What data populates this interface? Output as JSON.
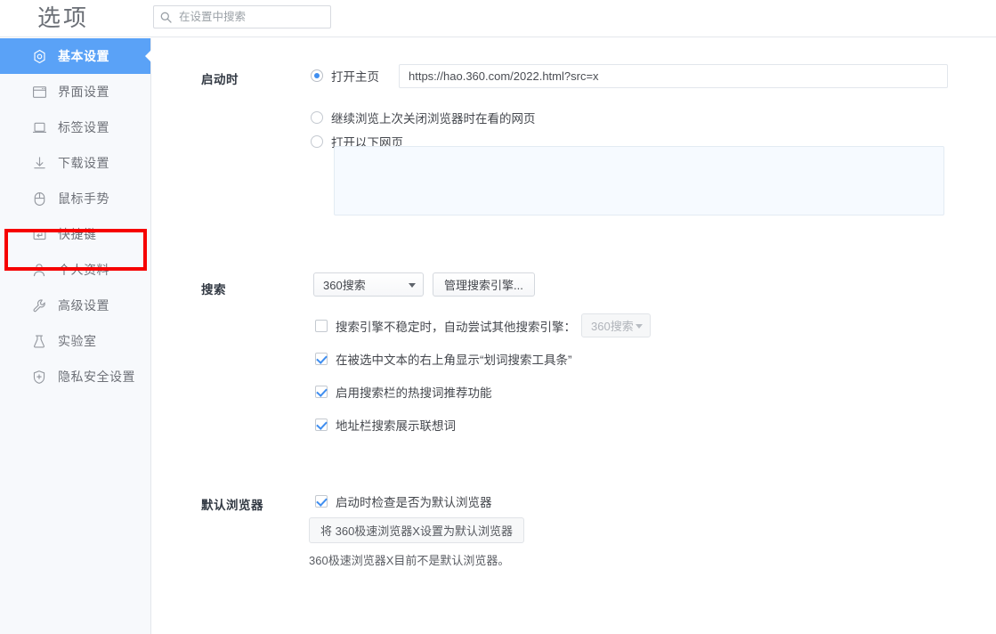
{
  "window": {
    "title": "选项"
  },
  "search": {
    "placeholder": "在设置中搜索",
    "value": "",
    "icon": "search-icon"
  },
  "sidebar": {
    "items": [
      {
        "label": "基本设置",
        "icon": "gear-target-icon",
        "active": true
      },
      {
        "label": "界面设置",
        "icon": "window-icon",
        "active": false
      },
      {
        "label": "标签设置",
        "icon": "tab-icon",
        "active": false
      },
      {
        "label": "下载设置",
        "icon": "download-icon",
        "active": false
      },
      {
        "label": "鼠标手势",
        "icon": "mouse-icon",
        "active": false
      },
      {
        "label": "快捷键",
        "icon": "keyboard-icon",
        "active": false,
        "highlighted": true
      },
      {
        "label": "个人资料",
        "icon": "user-icon",
        "active": false
      },
      {
        "label": "高级设置",
        "icon": "wrench-icon",
        "active": false
      },
      {
        "label": "实验室",
        "icon": "flask-icon",
        "active": false
      },
      {
        "label": "隐私安全设置",
        "icon": "shield-plus-icon",
        "active": false
      }
    ],
    "highlight_color": "#f60000",
    "active_color": "#5aa2f7"
  },
  "startup": {
    "label": "启动时",
    "options": [
      {
        "text": "打开主页",
        "selected": true
      },
      {
        "text": "继续浏览上次关闭浏览器时在看的网页",
        "selected": false
      },
      {
        "text": "打开以下网页",
        "selected": false
      }
    ],
    "homepage_url": "https://hao.360.com/2022.html?src=x",
    "pages_textarea": ""
  },
  "search_section": {
    "label": "搜索",
    "engine_select": "360搜索",
    "manage_button": "管理搜索引擎...",
    "fallback": {
      "checked": false,
      "text": "搜索引擎不稳定时，自动尝试其他搜索引擎：",
      "engine_select": "360搜索",
      "disabled": true
    },
    "checkboxes": [
      {
        "text": "在被选中文本的右上角显示“划词搜索工具条”",
        "checked": true
      },
      {
        "text": "启用搜索栏的热搜词推荐功能",
        "checked": true
      },
      {
        "text": "地址栏搜索展示联想词",
        "checked": true
      }
    ]
  },
  "default_browser": {
    "label": "默认浏览器",
    "check_on_startup": {
      "text": "启动时检查是否为默认浏览器",
      "checked": true
    },
    "set_button": "将 360极速浏览器X设置为默认浏览器",
    "status_note": "360极速浏览器X目前不是默认浏览器。"
  }
}
